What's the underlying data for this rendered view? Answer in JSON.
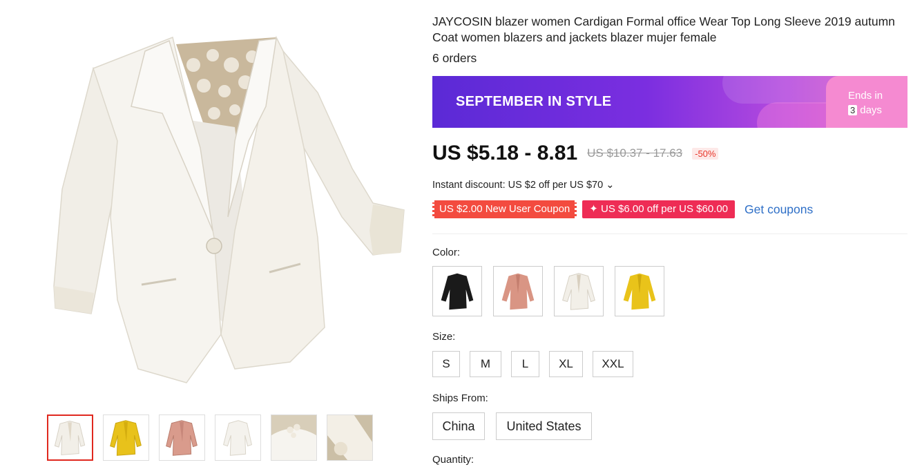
{
  "product": {
    "title": "JAYCOSIN blazer women Cardigan Formal office Wear Top Long Sleeve 2019 autumn Coat women blazers and jackets blazer mujer female",
    "orders": "6 orders"
  },
  "banner": {
    "text": "SEPTEMBER IN STYLE",
    "ends_label": "Ends in",
    "days_number": "3",
    "days_label": "days"
  },
  "price": {
    "current": "US $5.18 - 8.81",
    "original": "US $10.37 - 17.63",
    "discount": "-50%"
  },
  "instant_discount": "Instant discount: US $2 off per US $70 ⌄",
  "coupons": {
    "new_user": "US $2.00 New User Coupon",
    "store": "✦ US $6.00 off per US $60.00",
    "get_label": "Get coupons"
  },
  "color": {
    "label": "Color:",
    "options": [
      "black",
      "pink",
      "white",
      "yellow"
    ]
  },
  "size": {
    "label": "Size:",
    "options": [
      "S",
      "M",
      "L",
      "XL",
      "XXL"
    ]
  },
  "ships_from": {
    "label": "Ships From:",
    "options": [
      "China",
      "United States"
    ]
  },
  "quantity": {
    "label": "Quantity:"
  },
  "gallery": {
    "thumbnails": [
      "white-blazer",
      "yellow-blazer",
      "pink-blazer",
      "white-blazer-side",
      "lace-back-detail",
      "sleeve-detail"
    ],
    "active_index": 0
  },
  "colors": {
    "accent": "#e0281e",
    "banner_start": "#5b2ad6",
    "banner_end": "#e55fc0",
    "coupon_red": "#f34b3f",
    "coupon_pink": "#ee2c55",
    "link_blue": "#2e6fc7"
  }
}
